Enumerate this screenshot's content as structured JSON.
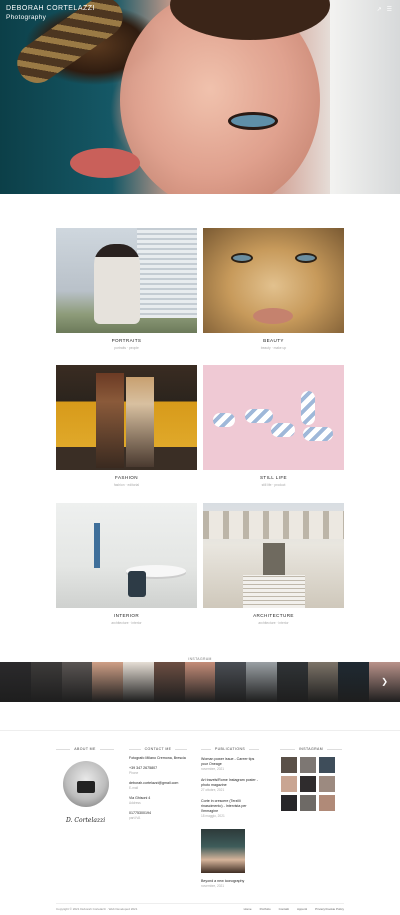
{
  "brand": {
    "name": "DEBORAH CORTELAZZI",
    "tagline": "Photography"
  },
  "header": {
    "icons": [
      "share-icon",
      "menu-icon"
    ]
  },
  "gallery": [
    {
      "title": "PORTRAITS",
      "sub": "portraits · people"
    },
    {
      "title": "BEAUTY",
      "sub": "beauty · make up"
    },
    {
      "title": "FASHION",
      "sub": "fashion · editorial"
    },
    {
      "title": "STILL LIFE",
      "sub": "still life · product"
    },
    {
      "title": "INTERIOR",
      "sub": "architecture · interior"
    },
    {
      "title": "ARCHITECTURE",
      "sub": "architecture · interior"
    }
  ],
  "instagram_label": "INSTAGRAM",
  "strip_colors": [
    "#2b2a2c",
    "#3d3b3a",
    "#5a5553",
    "#cf9f86",
    "#e6ded5",
    "#6d4f43",
    "#c48c78",
    "#4b4f55",
    "#9aa0a4",
    "#303437",
    "#7c7368",
    "#1f2a33",
    "#b9928a"
  ],
  "footer": {
    "about": {
      "heading": "ABOUT ME",
      "signature": "D. Cortelazzi"
    },
    "contact": {
      "heading": "CONTACT ME",
      "items": [
        {
          "value": "Fotografo Milano Cremona, Brescia",
          "key": ""
        },
        {
          "value": "+39 347 2675807",
          "key": "Phone"
        },
        {
          "value": "deborah.cortelazzi@gmail.com",
          "key": "E-mail"
        },
        {
          "value": "Via Ghisoni 4",
          "key": "Address"
        },
        {
          "value": "01775300194",
          "key": "part.IVA"
        }
      ]
    },
    "publications": {
      "heading": "PUBLICATIONS",
      "items": [
        {
          "title": "Woman power issue - Career tips your Oneage",
          "date": "novembre, 2021"
        },
        {
          "title": "Art travels/Rome Instagram poster - photo magazine",
          "date": "27 ottobre, 2021"
        },
        {
          "title": "Corte in crescere (Terzilli rinascimento) - Intervista per l'immagine",
          "date": "18 maggio, 2021"
        },
        {
          "title": "Beyond a new iconography",
          "date": "novembre, 2021"
        }
      ]
    },
    "instagram": {
      "heading": "INSTAGRAM",
      "thumbs": [
        "#5a5048",
        "#7d7773",
        "#3e4d5a",
        "#c9a592",
        "#2f2c2d",
        "#9c8a80",
        "#272629",
        "#6e6a66",
        "#b08a78"
      ]
    }
  },
  "bottom": {
    "copyright": "Copyright © 2021 Deborah Cortelazzi · Web Developed 2021",
    "links": [
      "Home",
      "Portfolio",
      "Contatti",
      "Appunti",
      "Privacy/Cookie Policy"
    ]
  }
}
